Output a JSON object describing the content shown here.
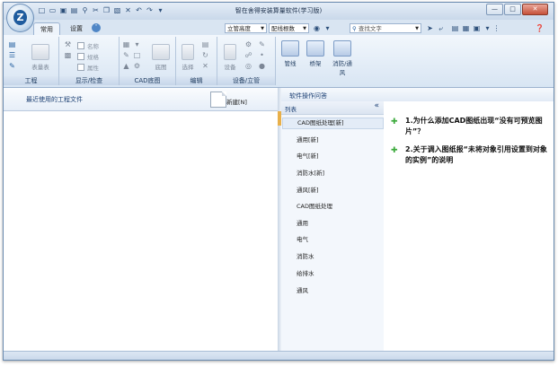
{
  "window": {
    "title": "智在舍得安装算量软件(学习版)",
    "logo_letter": "Z"
  },
  "tabs": [
    {
      "label": "常用"
    },
    {
      "label": "设置"
    }
  ],
  "toolbar": {
    "combo1": "立管高度",
    "combo2": "配线根数",
    "search_placeholder": "查找文字"
  },
  "ribbon": {
    "groups": {
      "project": "工程",
      "display": "显示/检查",
      "cad": "CAD底图",
      "edit": "编辑",
      "device": "设备/立管"
    },
    "buttons": {
      "table": "表量表",
      "underlay": "底图",
      "select": "选择",
      "device": "设备",
      "pipe": "管线",
      "bridge": "桥架",
      "fire": "消防/通风"
    },
    "checks": {
      "name": "名称",
      "spec": "规格",
      "attr": "属性"
    }
  },
  "left": {
    "heading": "最近使用的工程文件",
    "new_label": "新建[N]"
  },
  "help": {
    "heading": "软件操作问答",
    "list_title": "列表",
    "items": [
      "CAD图纸处理[新]",
      "通用[新]",
      "电气[新]",
      "消防水[新]",
      "通风[新]",
      "CAD图纸处理",
      "通用",
      "电气",
      "消防水",
      "给排水",
      "通风"
    ],
    "questions": [
      "1.为什么添加CAD图纸出现“没有可预览图片”？",
      "2.关于调入图纸报“未将对象引用设置到对象的实例”的说明"
    ]
  }
}
